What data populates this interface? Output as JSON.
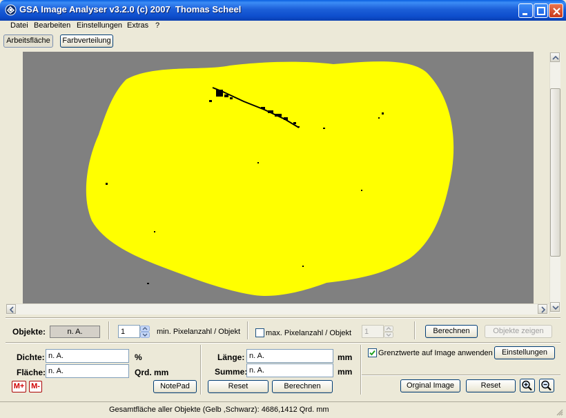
{
  "window": {
    "title": "GSA Image Analyser v3.2.0 (c) 2007  Thomas Scheel",
    "controls": [
      "minimize",
      "maximize",
      "close"
    ],
    "accent": "#0d4dcc"
  },
  "menu": {
    "items": [
      {
        "label": "Datei",
        "mnemonic": "D"
      },
      {
        "label": "Bearbeiten",
        "mnemonic": "B"
      },
      {
        "label": "Einstellungen",
        "mnemonic": "E"
      },
      {
        "label": "Extras",
        "mnemonic": "x"
      },
      {
        "label": "?"
      }
    ]
  },
  "tabs": {
    "work_area": "Arbeitsfläche",
    "color_distribution": "Farbverteilung"
  },
  "canvas": {
    "background": "#808080",
    "highlight_color": "#ffff00",
    "object_color": "#000000"
  },
  "objects_row": {
    "label": "Objekte:",
    "value": "n. A.",
    "min_pixels_value": "1",
    "min_pixels_label": "min. Pixelanzahl / Objekt",
    "max_pixels_checked": false,
    "max_pixels_label": "max. Pixelanzahl / Objekt",
    "max_pixels_value": "1",
    "calc_button": "Berechnen",
    "show_objects_button": "Objekte zeigen"
  },
  "density": {
    "label": "Dichte:",
    "value": "n. A.",
    "unit": "%"
  },
  "area": {
    "label": "Fläche:",
    "value": "n. A.",
    "unit": "Qrd. mm"
  },
  "memory": {
    "plus": "M+",
    "minus": "M-",
    "notepad": "NotePad"
  },
  "length": {
    "label": "Länge:",
    "value": "n. A.",
    "unit": "mm"
  },
  "sum": {
    "label": "Summe:",
    "value": "n. A.",
    "unit": "mm",
    "reset_button": "Reset",
    "calc_button": "Berechnen"
  },
  "thresholds": {
    "checked": true,
    "label": "Grenztwerte auf Image anwenden",
    "settings_button": "Einstellungen"
  },
  "image_controls": {
    "original_button": "Orginal Image",
    "reset_button": "Reset"
  },
  "status": {
    "text": "Gesamtfläche aller Objekte (Gelb ,Schwarz): 4686,1412 Qrd. mm"
  }
}
